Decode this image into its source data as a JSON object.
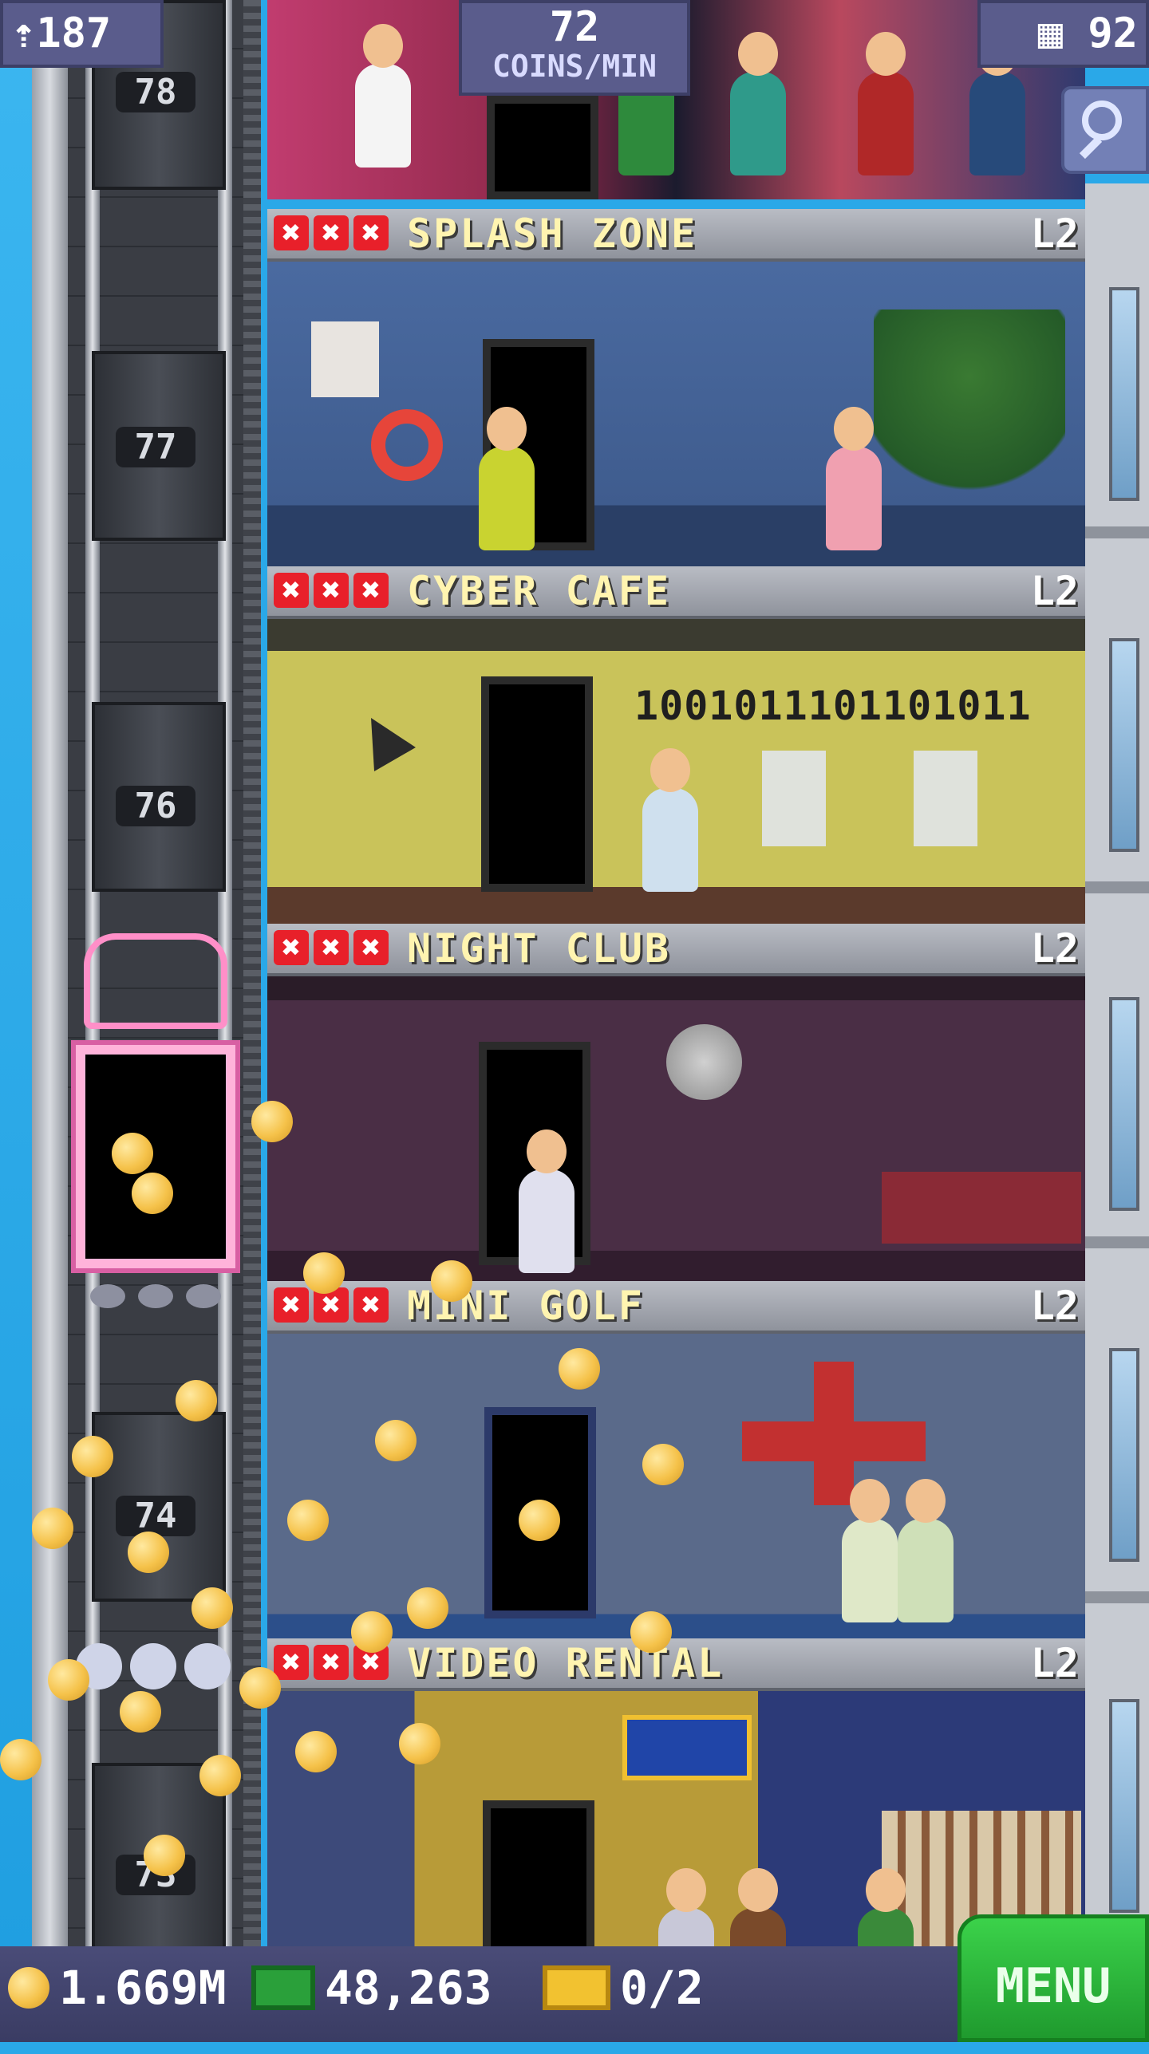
{
  "hud": {
    "population": "187",
    "coins_per_min_value": "72",
    "coins_per_min_unit": "COINS/MIN",
    "floor_count": "92"
  },
  "elevator_floors": [
    {
      "number": "78"
    },
    {
      "number": "77"
    },
    {
      "number": "76"
    },
    {
      "number": "74"
    },
    {
      "number": "73"
    }
  ],
  "floors": [
    {
      "name": "SPLASH ZONE",
      "level": "L2",
      "stars": [
        "✖",
        "✖",
        "✖"
      ],
      "wall": "#3f5c8e",
      "floor_color": "#2a3f66"
    },
    {
      "name": "CYBER CAFE",
      "level": "L2",
      "stars": [
        "✖",
        "✖",
        "✖"
      ],
      "wall": "#c9c35a",
      "floor_color": "#5b3a2c",
      "display_text": "1001011101101011"
    },
    {
      "name": "NIGHT CLUB",
      "level": "L2",
      "stars": [
        "✖",
        "✖",
        "✖"
      ],
      "wall": "#4a2e45",
      "floor_color": "#311d2e"
    },
    {
      "name": "MINI GOLF",
      "level": "L2",
      "stars": [
        "✖",
        "✖",
        "✖"
      ],
      "wall": "#5a6a8a",
      "floor_color": "#2c4f8a"
    },
    {
      "name": "VIDEO RENTAL",
      "level": "L2",
      "stars": [
        "✖",
        "✖",
        "✖"
      ],
      "wall": "#b89b38",
      "floor_color": "#2c3a78"
    }
  ],
  "bottom": {
    "coins": "1.669M",
    "bux": "48,263",
    "tickets": "0/2",
    "menu_label": "MENU"
  },
  "colors": {
    "hud_bg": "#5a5c8c",
    "floor_name_text": "#fff4b0",
    "menu_green": "#2fbf3d",
    "star_red": "#e8202a"
  },
  "icons": {
    "population": "person-up-icon",
    "floors": "building-icon",
    "search": "magnifier-icon",
    "coins": "coin-icon",
    "bux": "bux-icon",
    "tickets": "vip-ticket-icon"
  }
}
